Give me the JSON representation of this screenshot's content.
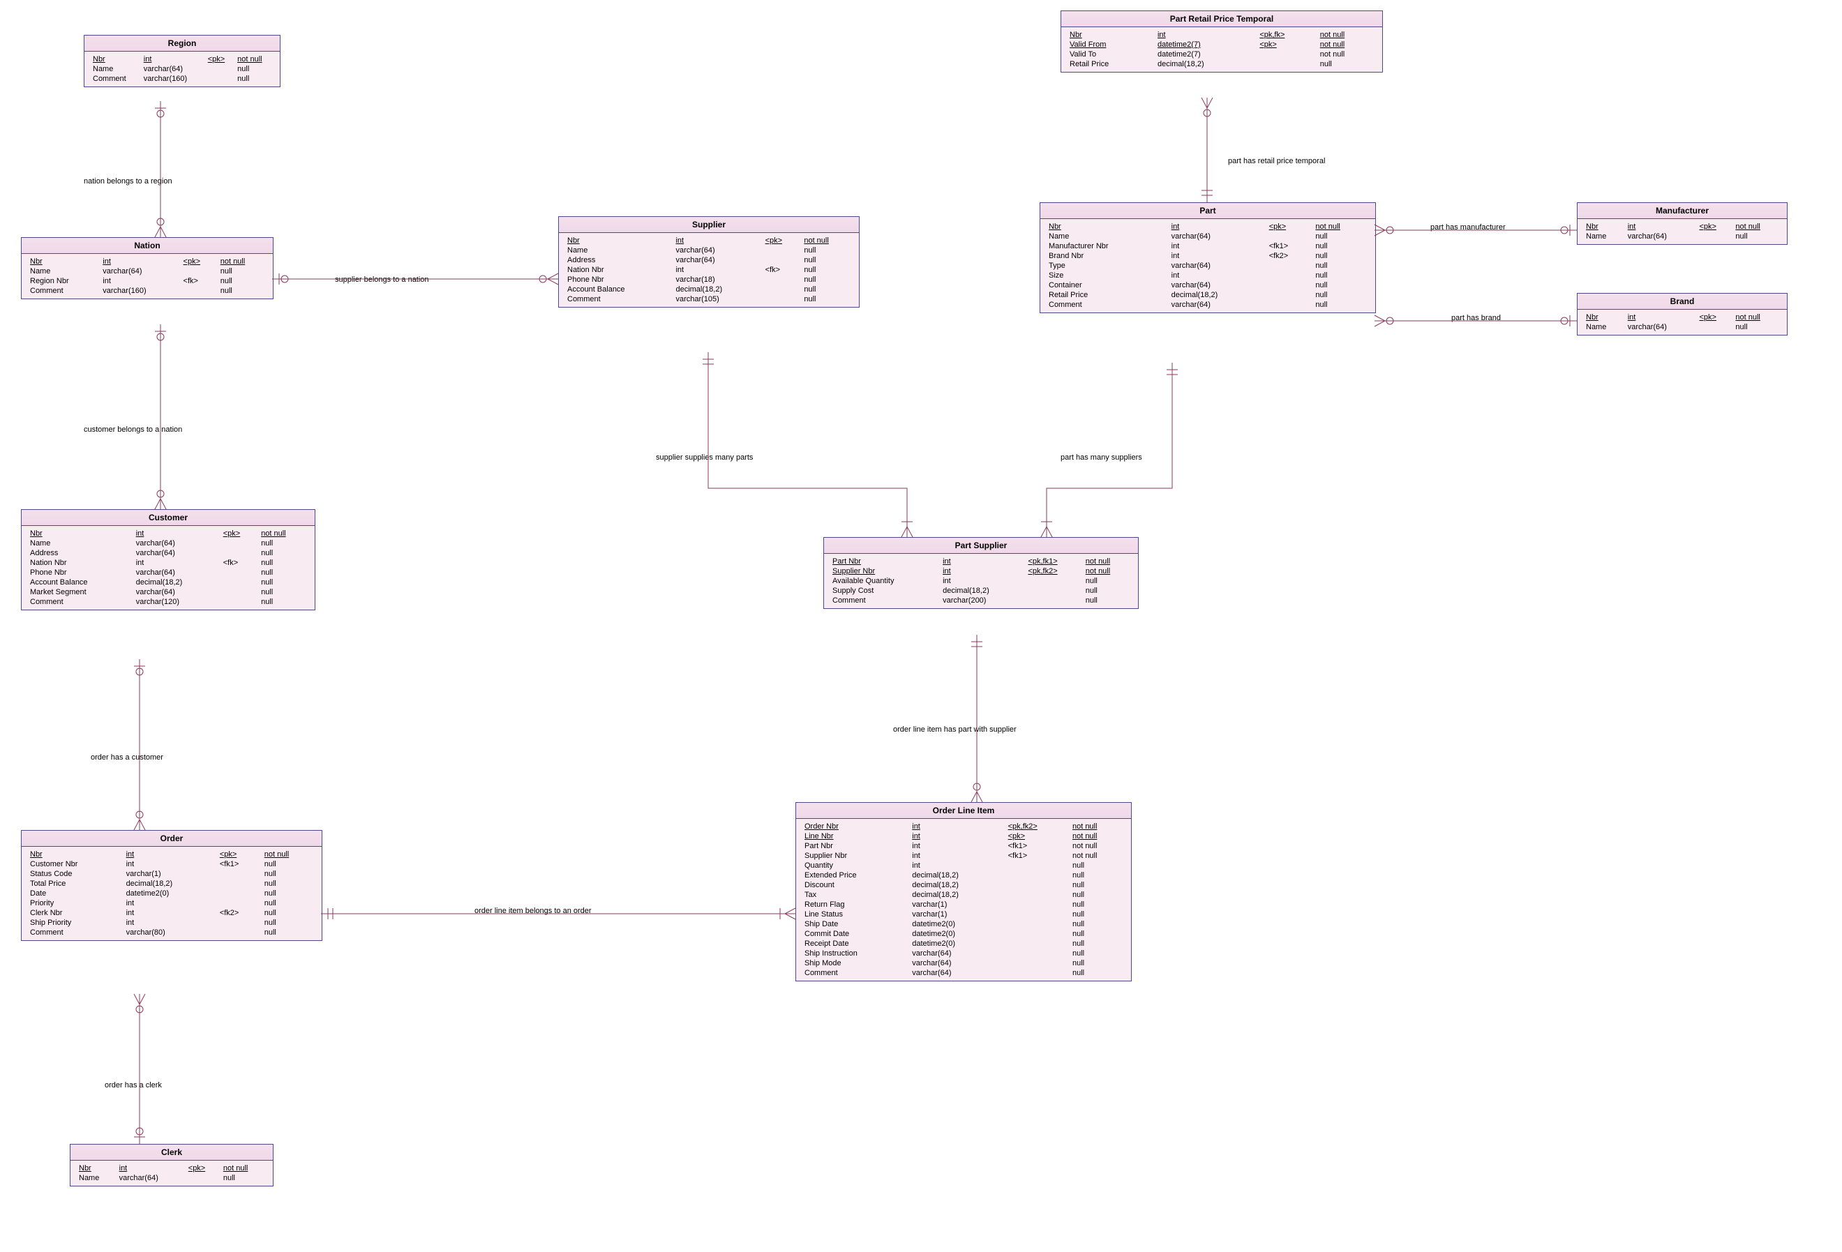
{
  "entities": {
    "region": {
      "title": "Region",
      "cols": [
        [
          "Nbr",
          "int",
          "<pk>",
          "not null",
          true
        ],
        [
          "Name",
          "varchar(64)",
          "",
          "null",
          false
        ],
        [
          "Comment",
          "varchar(160)",
          "",
          "null",
          false
        ]
      ]
    },
    "nation": {
      "title": "Nation",
      "cols": [
        [
          "Nbr",
          "int",
          "<pk>",
          "not null",
          true
        ],
        [
          "Name",
          "varchar(64)",
          "",
          "null",
          false
        ],
        [
          "Region Nbr",
          "int",
          "<fk>",
          "null",
          false
        ],
        [
          "Comment",
          "varchar(160)",
          "",
          "null",
          false
        ]
      ]
    },
    "customer": {
      "title": "Customer",
      "cols": [
        [
          "Nbr",
          "int",
          "<pk>",
          "not null",
          true
        ],
        [
          "Name",
          "varchar(64)",
          "",
          "null",
          false
        ],
        [
          "Address",
          "varchar(64)",
          "",
          "null",
          false
        ],
        [
          "Nation Nbr",
          "int",
          "<fk>",
          "null",
          false
        ],
        [
          "Phone Nbr",
          "varchar(64)",
          "",
          "null",
          false
        ],
        [
          "Account Balance",
          "decimal(18,2)",
          "",
          "null",
          false
        ],
        [
          "Market Segment",
          "varchar(64)",
          "",
          "null",
          false
        ],
        [
          "Comment",
          "varchar(120)",
          "",
          "null",
          false
        ]
      ]
    },
    "order": {
      "title": "Order",
      "cols": [
        [
          "Nbr",
          "int",
          "<pk>",
          "not null",
          true
        ],
        [
          "Customer Nbr",
          "int",
          "<fk1>",
          "null",
          false
        ],
        [
          "Status Code",
          "varchar(1)",
          "",
          "null",
          false
        ],
        [
          "Total Price",
          "decimal(18,2)",
          "",
          "null",
          false
        ],
        [
          "Date",
          "datetime2(0)",
          "",
          "null",
          false
        ],
        [
          "Priority",
          "int",
          "",
          "null",
          false
        ],
        [
          "Clerk Nbr",
          "int",
          "<fk2>",
          "null",
          false
        ],
        [
          "Ship Priority",
          "int",
          "",
          "null",
          false
        ],
        [
          "Comment",
          "varchar(80)",
          "",
          "null",
          false
        ]
      ]
    },
    "clerk": {
      "title": "Clerk",
      "cols": [
        [
          "Nbr",
          "int",
          "<pk>",
          "not null",
          true
        ],
        [
          "Name",
          "varchar(64)",
          "",
          "null",
          false
        ]
      ]
    },
    "supplier": {
      "title": "Supplier",
      "cols": [
        [
          "Nbr",
          "int",
          "<pk>",
          "not null",
          true
        ],
        [
          "Name",
          "varchar(64)",
          "",
          "null",
          false
        ],
        [
          "Address",
          "varchar(64)",
          "",
          "null",
          false
        ],
        [
          "Nation Nbr",
          "int",
          "<fk>",
          "null",
          false
        ],
        [
          "Phone Nbr",
          "varchar(18)",
          "",
          "null",
          false
        ],
        [
          "Account Balance",
          "decimal(18,2)",
          "",
          "null",
          false
        ],
        [
          "Comment",
          "varchar(105)",
          "",
          "null",
          false
        ]
      ]
    },
    "partsupplier": {
      "title": "Part Supplier",
      "cols": [
        [
          "Part Nbr",
          "int",
          "<pk,fk1>",
          "not null",
          true
        ],
        [
          "Supplier Nbr",
          "int",
          "<pk,fk2>",
          "not null",
          true
        ],
        [
          "Available Quantity",
          "int",
          "",
          "null",
          false
        ],
        [
          "Supply Cost",
          "decimal(18,2)",
          "",
          "null",
          false
        ],
        [
          "Comment",
          "varchar(200)",
          "",
          "null",
          false
        ]
      ]
    },
    "orderlineitem": {
      "title": "Order Line Item",
      "cols": [
        [
          "Order Nbr",
          "int",
          "<pk,fk2>",
          "not null",
          true
        ],
        [
          "Line Nbr",
          "int",
          "<pk>",
          "not null",
          true
        ],
        [
          "Part Nbr",
          "int",
          "<fk1>",
          "not null",
          false
        ],
        [
          "Supplier Nbr",
          "int",
          "<fk1>",
          "not null",
          false
        ],
        [
          "Quantity",
          "int",
          "",
          "null",
          false
        ],
        [
          "Extended Price",
          "decimal(18,2)",
          "",
          "null",
          false
        ],
        [
          "Discount",
          "decimal(18,2)",
          "",
          "null",
          false
        ],
        [
          "Tax",
          "decimal(18,2)",
          "",
          "null",
          false
        ],
        [
          "Return Flag",
          "varchar(1)",
          "",
          "null",
          false
        ],
        [
          "Line Status",
          "varchar(1)",
          "",
          "null",
          false
        ],
        [
          "Ship Date",
          "datetime2(0)",
          "",
          "null",
          false
        ],
        [
          "Commit Date",
          "datetime2(0)",
          "",
          "null",
          false
        ],
        [
          "Receipt Date",
          "datetime2(0)",
          "",
          "null",
          false
        ],
        [
          "Ship Instruction",
          "varchar(64)",
          "",
          "null",
          false
        ],
        [
          "Ship Mode",
          "varchar(64)",
          "",
          "null",
          false
        ],
        [
          "Comment",
          "varchar(64)",
          "",
          "null",
          false
        ]
      ]
    },
    "part": {
      "title": "Part",
      "cols": [
        [
          "Nbr",
          "int",
          "<pk>",
          "not null",
          true
        ],
        [
          "Name",
          "varchar(64)",
          "",
          "null",
          false
        ],
        [
          "Manufacturer Nbr",
          "int",
          "<fk1>",
          "null",
          false
        ],
        [
          "Brand Nbr",
          "int",
          "<fk2>",
          "null",
          false
        ],
        [
          "Type",
          "varchar(64)",
          "",
          "null",
          false
        ],
        [
          "Size",
          "int",
          "",
          "null",
          false
        ],
        [
          "Container",
          "varchar(64)",
          "",
          "null",
          false
        ],
        [
          "Retail Price",
          "decimal(18,2)",
          "",
          "null",
          false
        ],
        [
          "Comment",
          "varchar(64)",
          "",
          "null",
          false
        ]
      ]
    },
    "prt": {
      "title": "Part Retail Price Temporal",
      "cols": [
        [
          "Nbr",
          "int",
          "<pk,fk>",
          "not null",
          true
        ],
        [
          "Valid From",
          "datetime2(7)",
          "<pk>",
          "not null",
          true
        ],
        [
          "Valid To",
          "datetime2(7)",
          "",
          "not null",
          false
        ],
        [
          "Retail Price",
          "decimal(18,2)",
          "",
          "null",
          false
        ]
      ]
    },
    "manufacturer": {
      "title": "Manufacturer",
      "cols": [
        [
          "Nbr",
          "int",
          "<pk>",
          "not null",
          true
        ],
        [
          "Name",
          "varchar(64)",
          "",
          "null",
          false
        ]
      ]
    },
    "brand": {
      "title": "Brand",
      "cols": [
        [
          "Nbr",
          "int",
          "<pk>",
          "not null",
          true
        ],
        [
          "Name",
          "varchar(64)",
          "",
          "null",
          false
        ]
      ]
    }
  },
  "relations": {
    "r1": "nation belongs to a region",
    "r2": "customer belongs to a nation",
    "r3": "order has a customer",
    "r4": "order has a clerk",
    "r5": "supplier belongs to a nation",
    "r6": "supplier supplies many parts",
    "r7": "part has many suppliers",
    "r8": "order line item has part with supplier",
    "r9": "order line item belongs to an order",
    "r10": "part has retail price temporal",
    "r11": "part has manufacturer",
    "r12": "part has brand"
  }
}
